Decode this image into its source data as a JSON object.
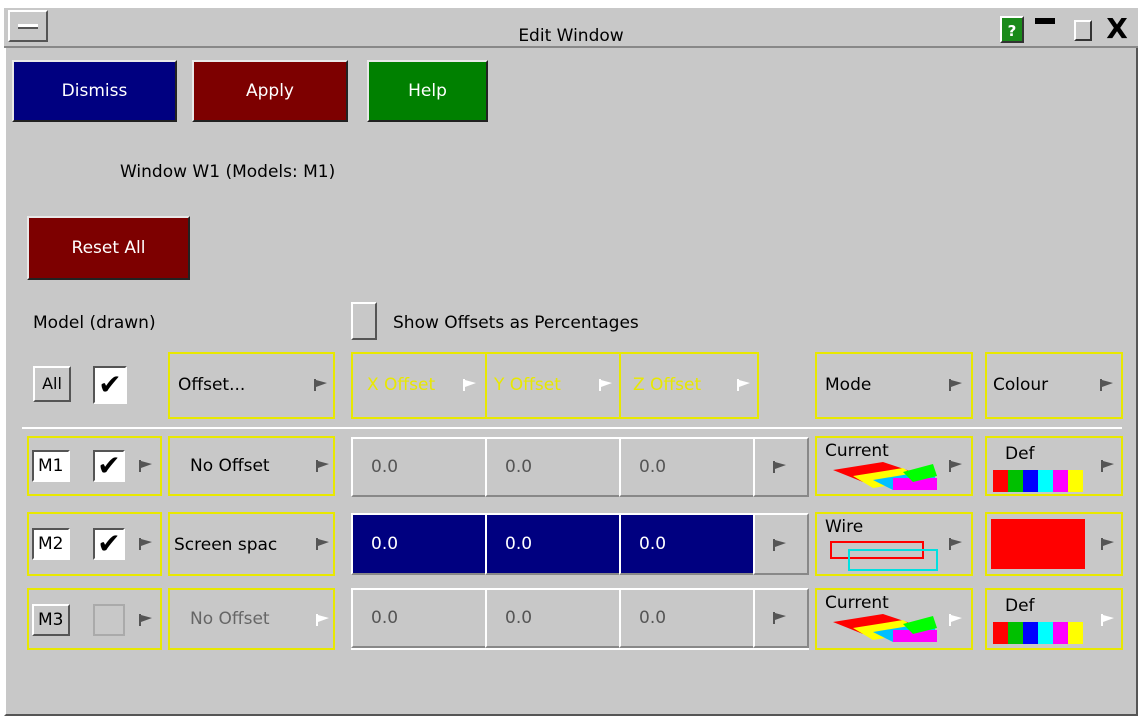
{
  "window": {
    "title": "Edit Window",
    "help_glyph": "?",
    "close_glyph": "X"
  },
  "buttons": {
    "dismiss": "Dismiss",
    "apply": "Apply",
    "help": "Help",
    "reset_all": "Reset All"
  },
  "info_label": "Window W1  (Models: M1)",
  "model_drawn_label": "Model (drawn)",
  "show_offsets_label": "Show Offsets as Percentages",
  "header": {
    "all_label": "All",
    "offset": "Offset...",
    "x_offset": "X Offset",
    "y_offset": "Y Offset",
    "z_offset": "Z Offset",
    "mode": "Mode",
    "colour": "Colour"
  },
  "rows": [
    {
      "model": "M1",
      "checked": true,
      "offset_type": "No Offset",
      "x": "0.0",
      "y": "0.0",
      "z": "0.0",
      "mode": "Current",
      "colour": "Def",
      "values_selected": false,
      "enabled": true
    },
    {
      "model": "M2",
      "checked": true,
      "offset_type": "Screen spac",
      "x": "0.0",
      "y": "0.0",
      "z": "0.0",
      "mode": "Wire",
      "colour": "",
      "values_selected": true,
      "enabled": true
    },
    {
      "model": "M3",
      "checked": false,
      "offset_type": "No Offset",
      "x": "0.0",
      "y": "0.0",
      "z": "0.0",
      "mode": "Current",
      "colour": "Def",
      "values_selected": false,
      "enabled": false
    }
  ],
  "colors": {
    "dismiss": "#000080",
    "apply": "#7d0000",
    "help": "#008000",
    "highlight_border": "#e8e800",
    "selected_cell": "#000080",
    "m2_colour_swatch": "#ff0000"
  },
  "icons": {
    "check": "✔",
    "menu_arrow": "flag-arrow-icon"
  }
}
